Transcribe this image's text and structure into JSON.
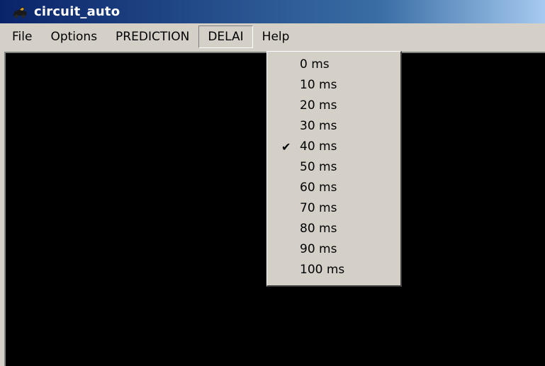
{
  "window": {
    "title": "circuit_auto",
    "icon": "car-icon"
  },
  "menubar": {
    "items": [
      {
        "label": "File"
      },
      {
        "label": "Options"
      },
      {
        "label": "PREDICTION"
      },
      {
        "label": "DELAI"
      },
      {
        "label": "Help"
      }
    ],
    "active": "DELAI"
  },
  "delai_menu": {
    "items": [
      {
        "label": "0 ms",
        "checked": false
      },
      {
        "label": "10 ms",
        "checked": false
      },
      {
        "label": "20 ms",
        "checked": false
      },
      {
        "label": "30 ms",
        "checked": false
      },
      {
        "label": "40 ms",
        "checked": true
      },
      {
        "label": "50 ms",
        "checked": false
      },
      {
        "label": "60 ms",
        "checked": false
      },
      {
        "label": "70 ms",
        "checked": false
      },
      {
        "label": "80 ms",
        "checked": false
      },
      {
        "label": "90 ms",
        "checked": false
      },
      {
        "label": "100 ms",
        "checked": false
      }
    ],
    "check_glyph": "✔"
  },
  "colors": {
    "titlebar_start": "#0a246a",
    "menu_bg": "#d4d0c8",
    "canvas_bg": "#000000"
  }
}
